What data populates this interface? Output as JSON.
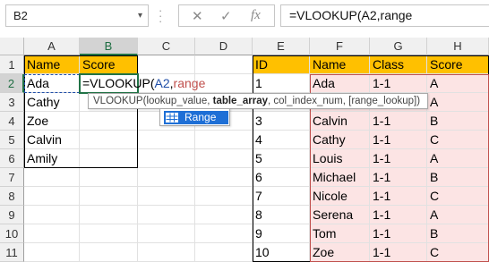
{
  "formula_bar": {
    "name_box": "B2",
    "name_box_dropdown": "▾",
    "cancel_icon": "✕",
    "enter_icon": "✓",
    "fx_label": "fx",
    "formula": "=VLOOKUP(A2,range"
  },
  "columns": [
    "A",
    "B",
    "C",
    "D",
    "E",
    "F",
    "G",
    "H"
  ],
  "rows": [
    "1",
    "2",
    "3",
    "4",
    "5",
    "6",
    "7",
    "8",
    "9",
    "10",
    "11"
  ],
  "cells": {
    "A1": "Name",
    "B1": "Score",
    "A2": "Ada",
    "A3": "Cathy",
    "A4": "Zoe",
    "A5": "Calvin",
    "A6": "Amily",
    "B2_fn": "=VLOOKUP(",
    "B2_ref": "A2",
    "B2_comma": ",",
    "B2_range": "range",
    "E1": "ID",
    "F1": "Name",
    "G1": "Class",
    "H1": "Score",
    "E2": "1",
    "F2": "Ada",
    "G2": "1-1",
    "H2": "A",
    "H3": "A",
    "E4": "3",
    "F4": "Calvin",
    "G4": "1-1",
    "H4": "B",
    "E5": "4",
    "F5": "Cathy",
    "G5": "1-1",
    "H5": "C",
    "E6": "5",
    "F6": "Louis",
    "G6": "1-1",
    "H6": "A",
    "E7": "6",
    "F7": "Michael",
    "G7": "1-1",
    "H7": "B",
    "E8": "7",
    "F8": "Nicole",
    "G8": "1-1",
    "H8": "C",
    "E9": "8",
    "F9": "Serena",
    "G9": "1-1",
    "H9": "A",
    "E10": "9",
    "F10": "Tom",
    "G10": "1-1",
    "H10": "B",
    "E11": "10",
    "F11": "Zoe",
    "G11": "1-1",
    "H11": "C"
  },
  "tooltip": {
    "fn": "VLOOKUP(",
    "arg1": "lookup_value, ",
    "arg2": "table_array",
    "rest": ", col_index_num, [range_lookup])"
  },
  "autocomplete": {
    "item": "Range",
    "icon": "table-range-icon"
  },
  "colors": {
    "header_fill": "#ffc000",
    "range_fill": "#fce4e4",
    "range_border": "#c0504d",
    "selection": "#217346",
    "ref_color": "#1f4ea8",
    "range_text": "#c0504d",
    "autocomplete_highlight": "#1e6fd6"
  }
}
